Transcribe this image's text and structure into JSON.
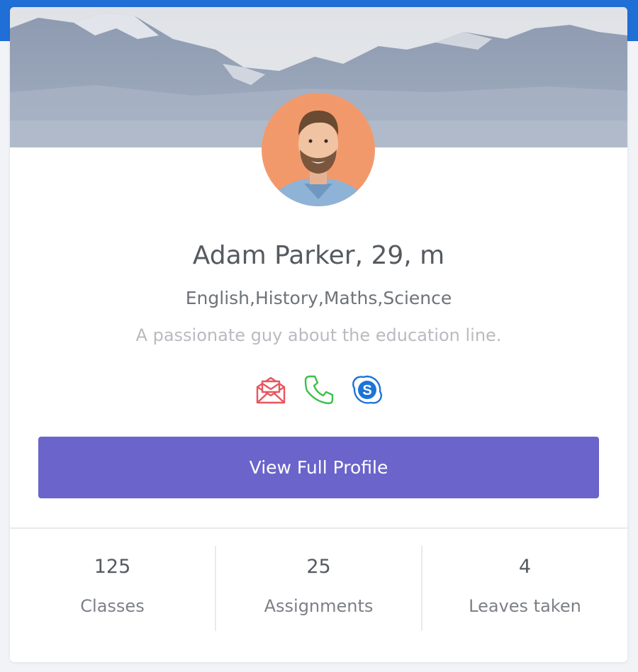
{
  "profile": {
    "name_line": "Adam Parker, 29, m",
    "subjects": "English,History,Maths,Science",
    "bio": "A passionate guy about the education line."
  },
  "contact_icons": [
    {
      "name": "mail-icon",
      "color": "#e8555f"
    },
    {
      "name": "phone-icon",
      "color": "#3cc14a"
    },
    {
      "name": "skype-icon",
      "color": "#1e74d6"
    }
  ],
  "actions": {
    "view_profile_label": "View Full Profile"
  },
  "stats": [
    {
      "value": "125",
      "label": "Classes"
    },
    {
      "value": "25",
      "label": "Assignments"
    },
    {
      "value": "4",
      "label": "Leaves taken"
    }
  ],
  "colors": {
    "topbar": "#1f6fd6",
    "button": "#6a64cb",
    "avatar_bg": "#f2996b"
  }
}
